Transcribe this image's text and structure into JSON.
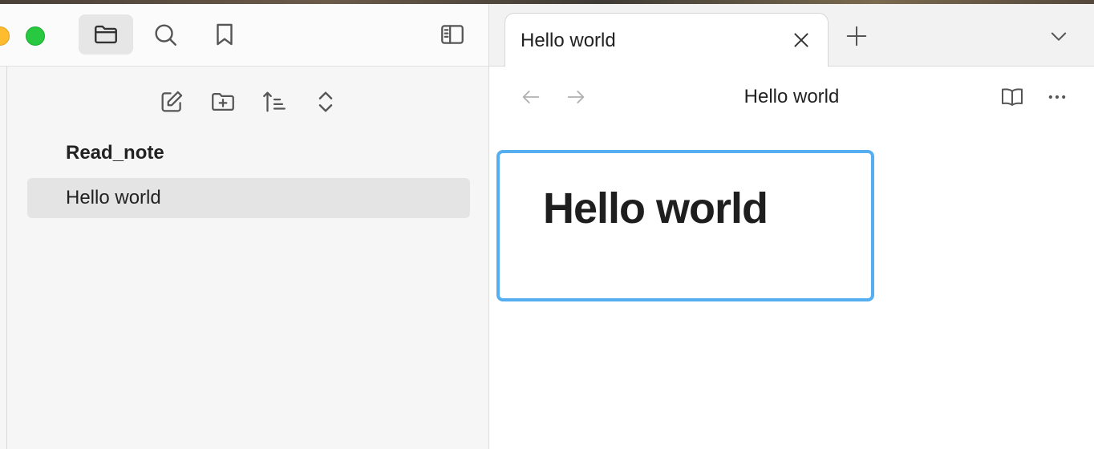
{
  "sidebar": {
    "tree": {
      "folder": "Read_note",
      "files": [
        "Hello world"
      ]
    }
  },
  "tabs": [
    {
      "title": "Hello world"
    }
  ],
  "view": {
    "title": "Hello world"
  },
  "editor": {
    "heading": "Hello world"
  },
  "colors": {
    "accent": "#55aef0",
    "selected_bg": "#e4e4e4",
    "traffic_yellow": "#febc2e",
    "traffic_green": "#28c840"
  },
  "icons": {
    "toolbar": [
      "folder-icon",
      "search-icon",
      "bookmark-icon",
      "sidebar-toggle-icon"
    ],
    "actions": [
      "new-note-icon",
      "new-folder-icon",
      "sort-icon",
      "collapse-icon"
    ]
  }
}
